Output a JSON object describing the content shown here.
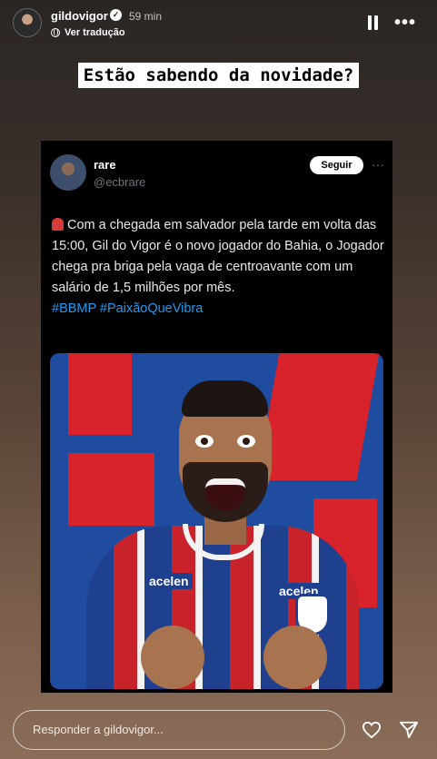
{
  "header": {
    "username": "gildovigor",
    "time": "59 min",
    "translate_label": "Ver tradução",
    "more_label": "•••"
  },
  "caption": "Estão sabendo da novidade?",
  "tweet": {
    "name": "rare",
    "handle": "@ecbrare",
    "follow_label": "Seguir",
    "more_label": "···",
    "text": "Com a chegada em salvador pela tarde em volta das 15:00, Gil do Vigor é o novo jogador do Bahia, o Jogador chega pra briga pela vaga de centroavante com um salário de 1,5 milhões por mês.",
    "hashtags": "#BBMP #PaixãoQueVibra",
    "image": {
      "sponsor_left": "acelen",
      "sponsor_right": "acelen"
    }
  },
  "footer": {
    "reply_placeholder": "Responder a gildovigor..."
  },
  "colors": {
    "tweet_bg": "#000000",
    "hashtag": "#1d9bf0",
    "bahia_blue": "#1f3f8f",
    "bahia_red": "#d8232a"
  }
}
